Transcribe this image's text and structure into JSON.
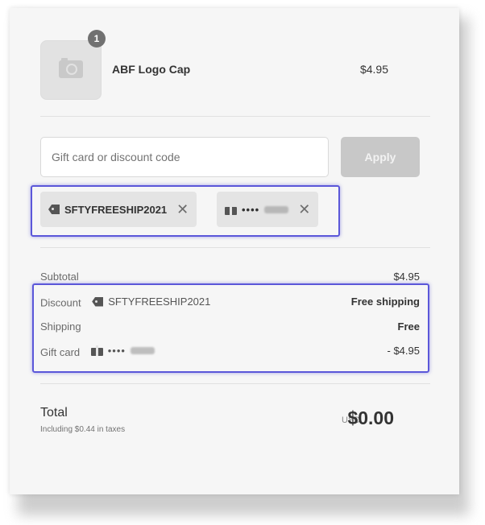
{
  "product": {
    "quantity": "1",
    "name": "ABF Logo Cap",
    "price": "$4.95",
    "image_icon": "camera-icon"
  },
  "discount_form": {
    "placeholder": "Gift card or discount code",
    "apply_label": "Apply"
  },
  "applied": [
    {
      "icon": "tag-icon",
      "label": "SFTYFREESHIP2021",
      "remove": "✕"
    },
    {
      "icon": "gift-icon",
      "label": "••••",
      "remove": "✕"
    }
  ],
  "summary": {
    "subtotal_label": "Subtotal",
    "subtotal_value": "$4.95",
    "discount_label": "Discount",
    "discount_code": "SFTYFREESHIP2021",
    "discount_value": "Free shipping",
    "shipping_label": "Shipping",
    "shipping_value": "Free",
    "giftcard_label": "Gift card",
    "giftcard_masked": "••••",
    "giftcard_value": "- $4.95"
  },
  "total": {
    "label": "Total",
    "taxes_note": "Including $0.44 in taxes",
    "currency": "USD",
    "amount": "$0.00"
  },
  "colors": {
    "highlight": "#5b57d9",
    "apply_button": "#c8c8c8",
    "panel_bg": "#f6f6f6"
  }
}
